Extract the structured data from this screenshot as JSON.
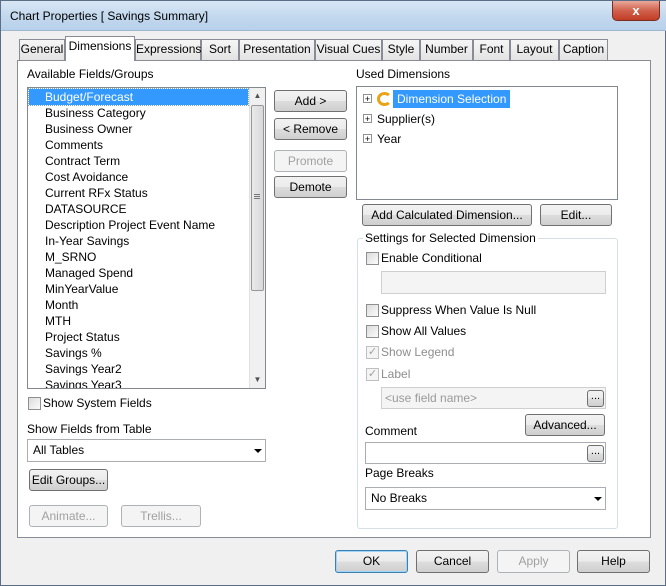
{
  "window": {
    "title": "Chart Properties [ Savings Summary]",
    "close_glyph": "x"
  },
  "tabs": [
    "General",
    "Dimensions",
    "Expressions",
    "Sort",
    "Presentation",
    "Visual Cues",
    "Style",
    "Number",
    "Font",
    "Layout",
    "Caption"
  ],
  "active_tab": "Dimensions",
  "available": {
    "label": "Available Fields/Groups",
    "items": [
      "Budget/Forecast",
      "Business Category",
      "Business Owner",
      "Comments",
      "Contract Term",
      "Cost Avoidance",
      "Current RFx Status",
      "DATASOURCE",
      "Description Project Event Name",
      "In-Year Savings",
      "M_SRNO",
      "Managed Spend",
      "MinYearValue",
      "Month",
      "MTH",
      "Project Status",
      "Savings %",
      "Savings Year2",
      "Savings Year3"
    ],
    "selected": "Budget/Forecast"
  },
  "show_system_fields_label": "Show System Fields",
  "show_fields_from_label": "Show Fields from Table",
  "show_fields_from_value": "All Tables",
  "buttons": {
    "add": "Add >",
    "remove": "< Remove",
    "promote": "Promote",
    "demote": "Demote",
    "edit_groups": "Edit Groups...",
    "animate": "Animate...",
    "trellis": "Trellis...",
    "add_calculated": "Add Calculated Dimension...",
    "edit": "Edit...",
    "advanced": "Advanced...",
    "ellipsis": "...",
    "ok": "OK",
    "cancel": "Cancel",
    "apply": "Apply",
    "help": "Help"
  },
  "used": {
    "label": "Used Dimensions",
    "items": [
      "Dimension Selection",
      "Supplier(s)",
      "Year"
    ],
    "selected": "Dimension Selection",
    "expander_glyph": "+"
  },
  "settings": {
    "group_label": "Settings for Selected Dimension",
    "enable_conditional": "Enable Conditional",
    "suppress_null": "Suppress When Value Is Null",
    "show_all_values": "Show All Values",
    "show_legend": "Show Legend",
    "label": "Label",
    "label_placeholder": "<use field name>",
    "comment": "Comment",
    "page_breaks": "Page Breaks",
    "page_breaks_value": "No Breaks",
    "check_glyph": "✓"
  },
  "colors": {
    "selection": "#3399ff",
    "titlebar": "#c2d8ee",
    "close_button": "#c23d25"
  }
}
